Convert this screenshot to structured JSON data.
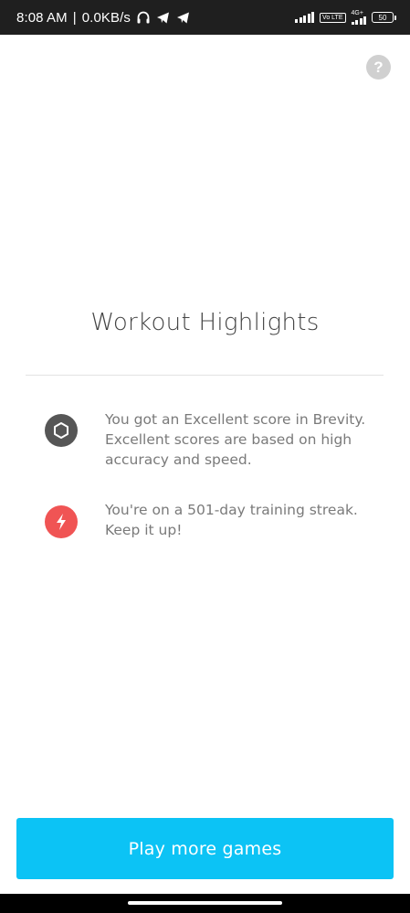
{
  "status_bar": {
    "time": "8:08 AM",
    "separator": "|",
    "network_speed": "0.0KB/s",
    "icons_left": [
      "headphones-icon",
      "telegram-icon",
      "telegram-icon"
    ],
    "network_label": "4G+",
    "volte_label": "Vo LTE",
    "battery": "50"
  },
  "help": {
    "label": "?"
  },
  "main": {
    "title": "Workout Highlights",
    "highlights": [
      {
        "icon": "hexagon-icon",
        "color": "#565656",
        "text": "You got an Excellent score in Brevity. Excellent scores are based on high accuracy and speed."
      },
      {
        "icon": "lightning-icon",
        "color": "#f05454",
        "text": "You're on a 501-day training streak. Keep it up!"
      }
    ]
  },
  "cta": {
    "label": "Play more games",
    "color": "#0cc3f5"
  }
}
